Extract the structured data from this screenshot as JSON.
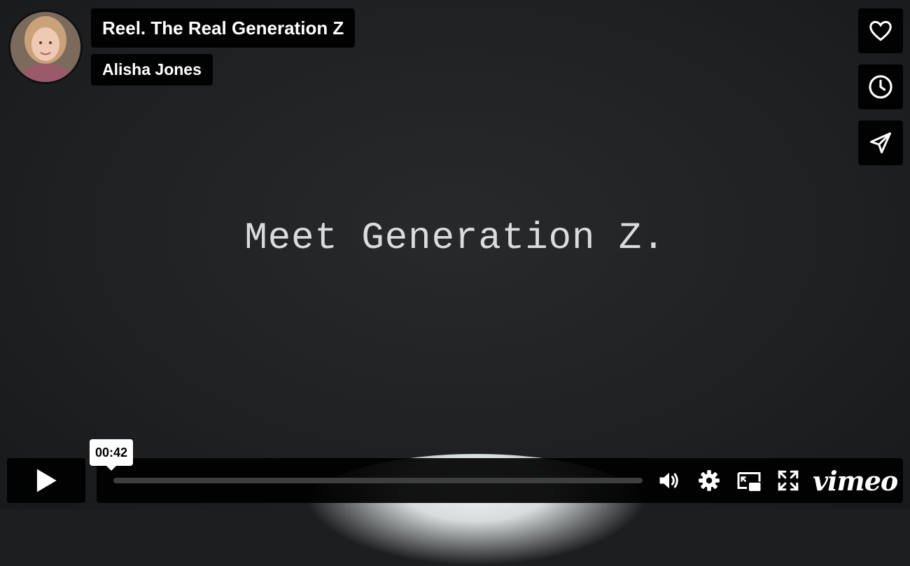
{
  "video": {
    "title": "Reel. The Real Generation Z",
    "author": "Alisha Jones",
    "frame_text": "Meet Generation Z."
  },
  "side_actions": [
    {
      "name": "like",
      "icon": "heart-icon"
    },
    {
      "name": "watch-later",
      "icon": "clock-icon"
    },
    {
      "name": "share",
      "icon": "paper-plane-icon"
    }
  ],
  "controls": {
    "play_icon": "play-icon",
    "hover_time": "00:42",
    "progress_fraction": 0.0,
    "icons": [
      "volume-icon",
      "gear-icon",
      "picture-in-picture-icon",
      "fullscreen-icon"
    ],
    "logo": "vimeo"
  },
  "colors": {
    "overlay": "#000000",
    "text": "#ffffff",
    "frame_text": "#d9dcdc"
  }
}
